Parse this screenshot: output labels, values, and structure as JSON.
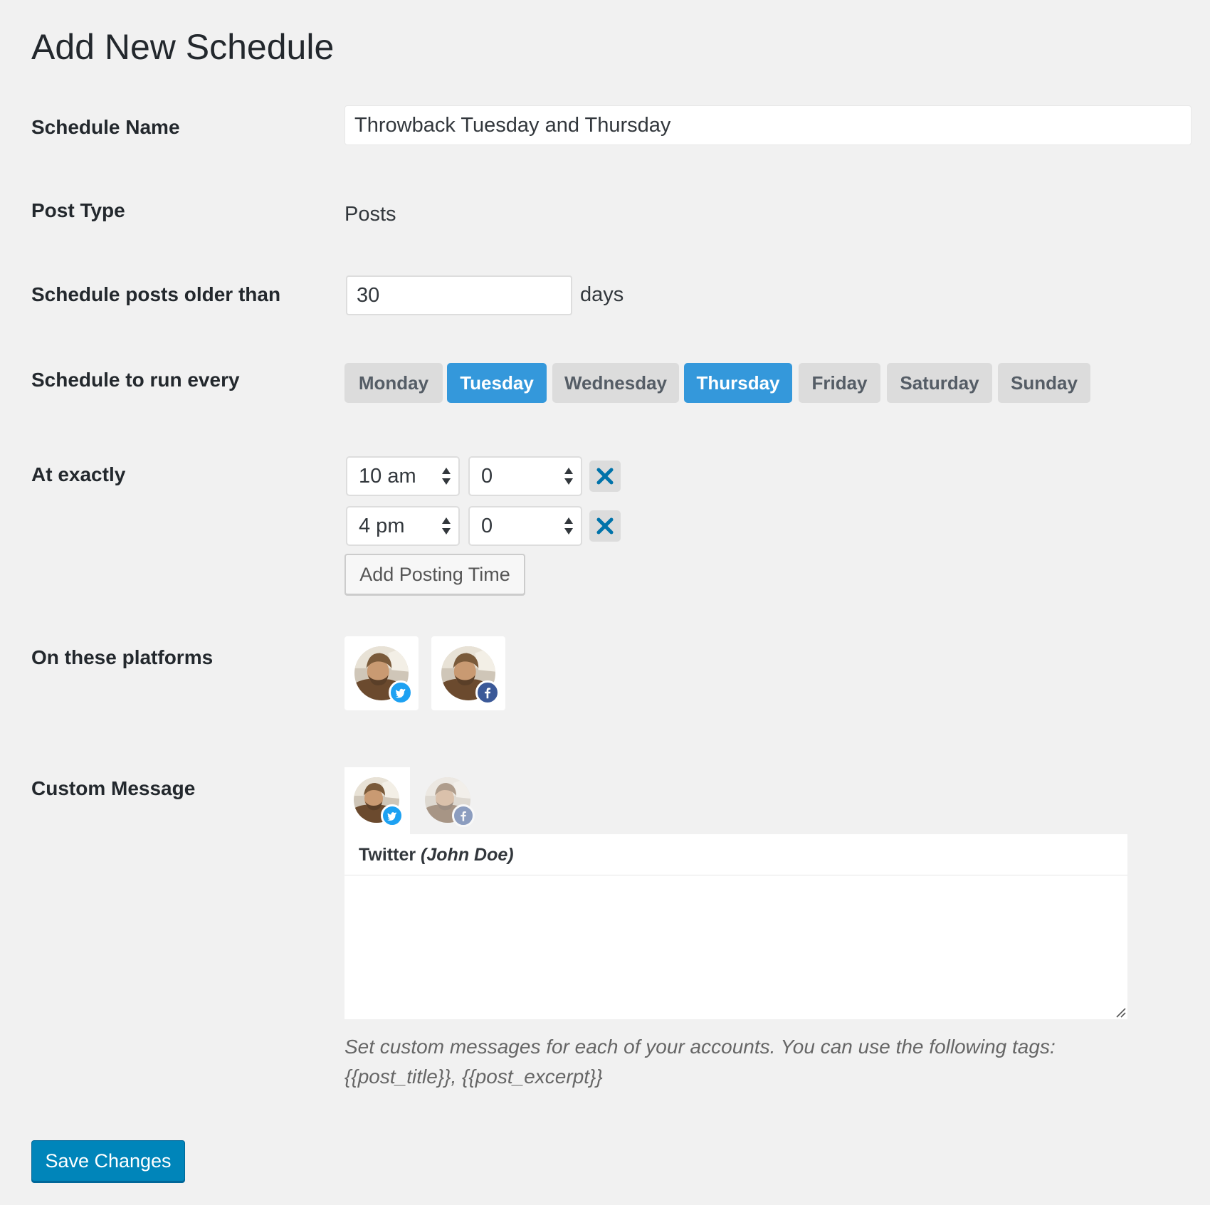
{
  "page": {
    "title": "Add New Schedule"
  },
  "schedule_name": {
    "label": "Schedule Name",
    "value": "Throwback Tuesday and Thursday"
  },
  "post_type": {
    "label": "Post Type",
    "value": "Posts"
  },
  "older_than": {
    "label": "Schedule posts older than",
    "value": "30",
    "unit": "days"
  },
  "run_every": {
    "label": "Schedule to run every",
    "days": [
      {
        "label": "Monday",
        "selected": false
      },
      {
        "label": "Tuesday",
        "selected": true
      },
      {
        "label": "Wednesday",
        "selected": false
      },
      {
        "label": "Thursday",
        "selected": true
      },
      {
        "label": "Friday",
        "selected": false
      },
      {
        "label": "Saturday",
        "selected": false
      },
      {
        "label": "Sunday",
        "selected": false
      }
    ]
  },
  "at_exactly": {
    "label": "At exactly",
    "times": [
      {
        "hour": "10 am",
        "minute": "0"
      },
      {
        "hour": "4 pm",
        "minute": "0"
      }
    ],
    "add_button": "Add Posting Time"
  },
  "platforms": {
    "label": "On these platforms",
    "accounts": [
      {
        "network": "twitter",
        "icon": "twitter-icon",
        "selected": true
      },
      {
        "network": "facebook",
        "icon": "facebook-icon",
        "selected": true
      }
    ]
  },
  "custom_message": {
    "label": "Custom Message",
    "tabs": [
      {
        "network": "twitter",
        "active": true
      },
      {
        "network": "facebook",
        "active": false
      }
    ],
    "panel_network": "Twitter",
    "panel_account": "(John Doe)",
    "message": "",
    "help_text": "Set custom messages for each of your accounts. You can use the following tags: {{post_title}}, {{post_excerpt}}"
  },
  "save_button": "Save Changes",
  "colors": {
    "background": "#f1f1f1",
    "day_active": "#3498db",
    "day_inactive": "#dcdcdc",
    "primary_button": "#0085ba",
    "remove_icon": "#0073aa",
    "twitter": "#1da1f2",
    "facebook": "#3b5998"
  }
}
